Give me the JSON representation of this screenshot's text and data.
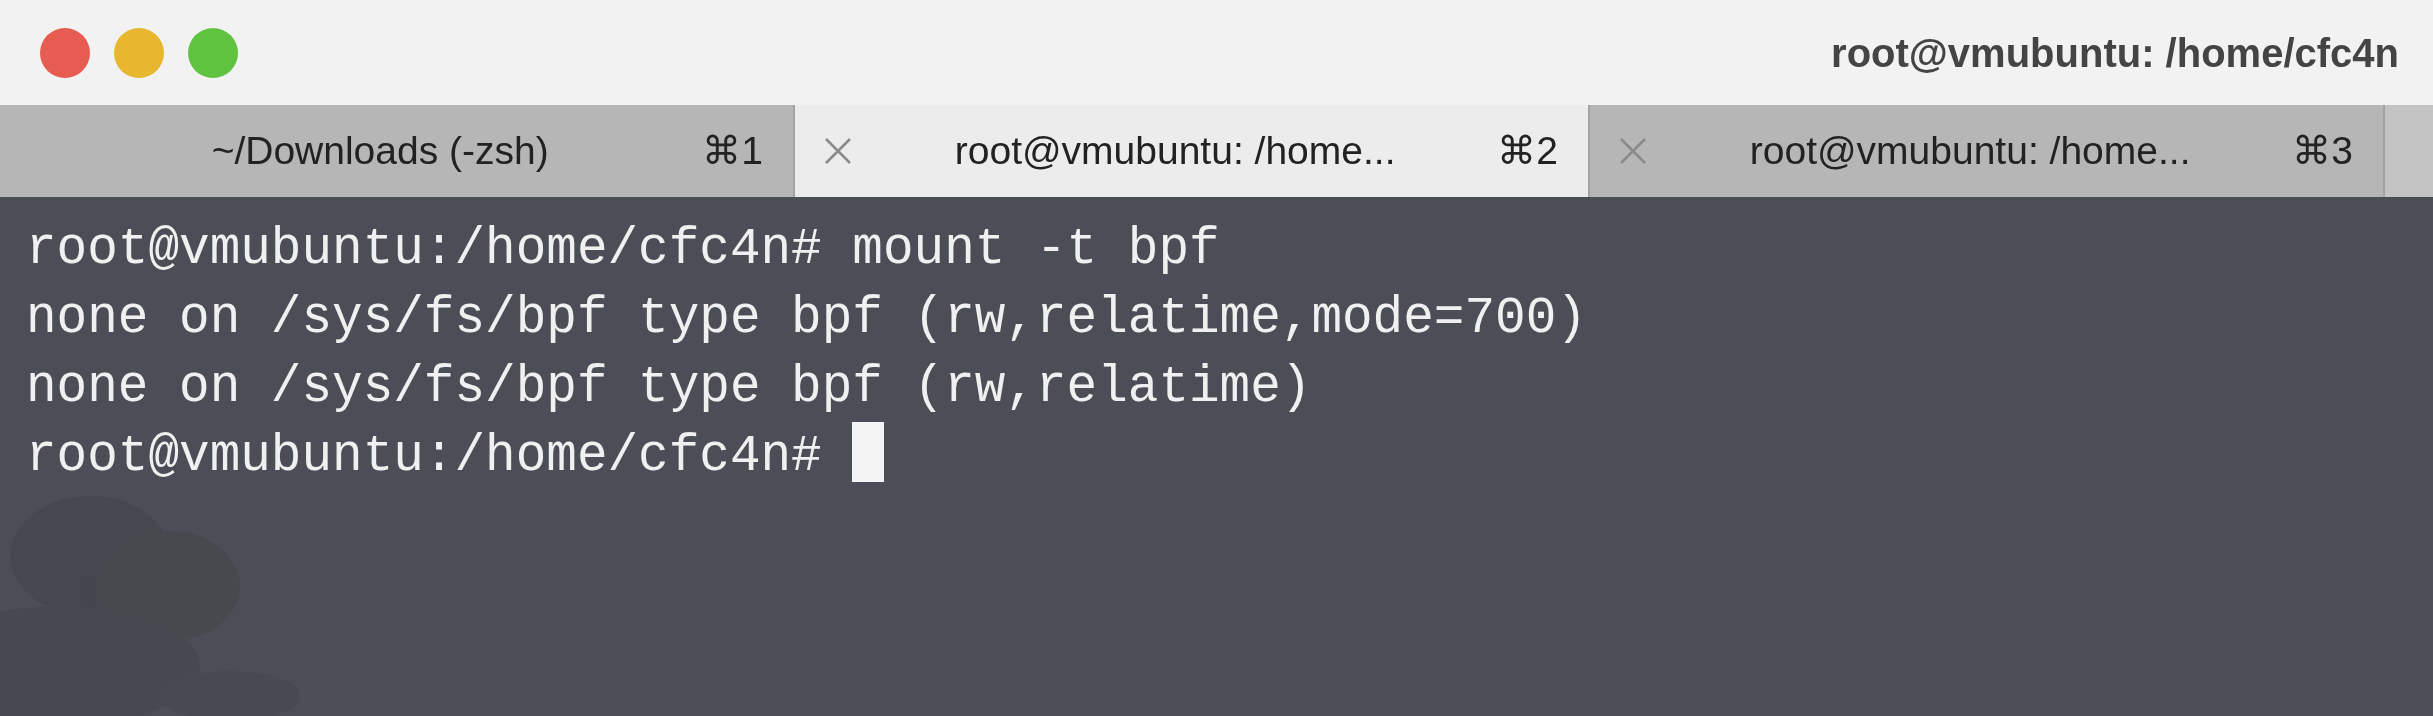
{
  "window": {
    "title": "root@vmubuntu: /home/cfc4n"
  },
  "tabs": [
    {
      "label": "~/Downloads (-zsh)",
      "shortcut": "⌘1",
      "selected": false,
      "close_shown": false
    },
    {
      "label": "root@vmubuntu: /home...",
      "shortcut": "⌘2",
      "selected": true,
      "close_shown": true
    },
    {
      "label": "root@vmubuntu: /home...",
      "shortcut": "⌘3",
      "selected": false,
      "close_shown": true
    }
  ],
  "terminal": {
    "lines": [
      "root@vmubuntu:/home/cfc4n# mount -t bpf",
      "none on /sys/fs/bpf type bpf (rw,relatime,mode=700)",
      "none on /sys/fs/bpf type bpf (rw,relatime)",
      "root@vmubuntu:/home/cfc4n# "
    ],
    "cursor_shown": true
  }
}
